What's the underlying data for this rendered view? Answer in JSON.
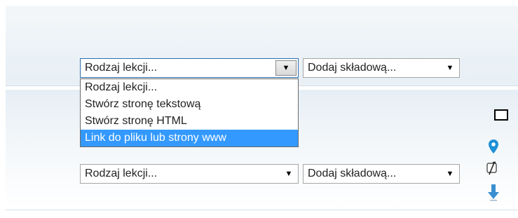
{
  "row1": {
    "lesson_type_select": {
      "value": "Rodzaj lekcji..."
    },
    "add_component_select": {
      "value": "Dodaj składową..."
    }
  },
  "dropdown": {
    "options": [
      "Rodzaj lekcji...",
      "Stwórz stronę tekstową",
      "Stwórz stronę HTML",
      "Link do pliku lub strony www"
    ],
    "highlighted_index": 3
  },
  "row2": {
    "lesson_type_select": {
      "value": "Rodzaj lekcji..."
    },
    "add_component_select": {
      "value": "Dodaj składową..."
    }
  },
  "side_icons": [
    {
      "name": "square-outline-icon"
    },
    {
      "name": "location-pin-icon",
      "color": "#1e90d6"
    },
    {
      "name": "edit-icon"
    },
    {
      "name": "move-down-icon",
      "color": "#3a8fd0"
    }
  ],
  "colors": {
    "highlight": "#3399ff",
    "icon_blue": "#1e90d6"
  }
}
